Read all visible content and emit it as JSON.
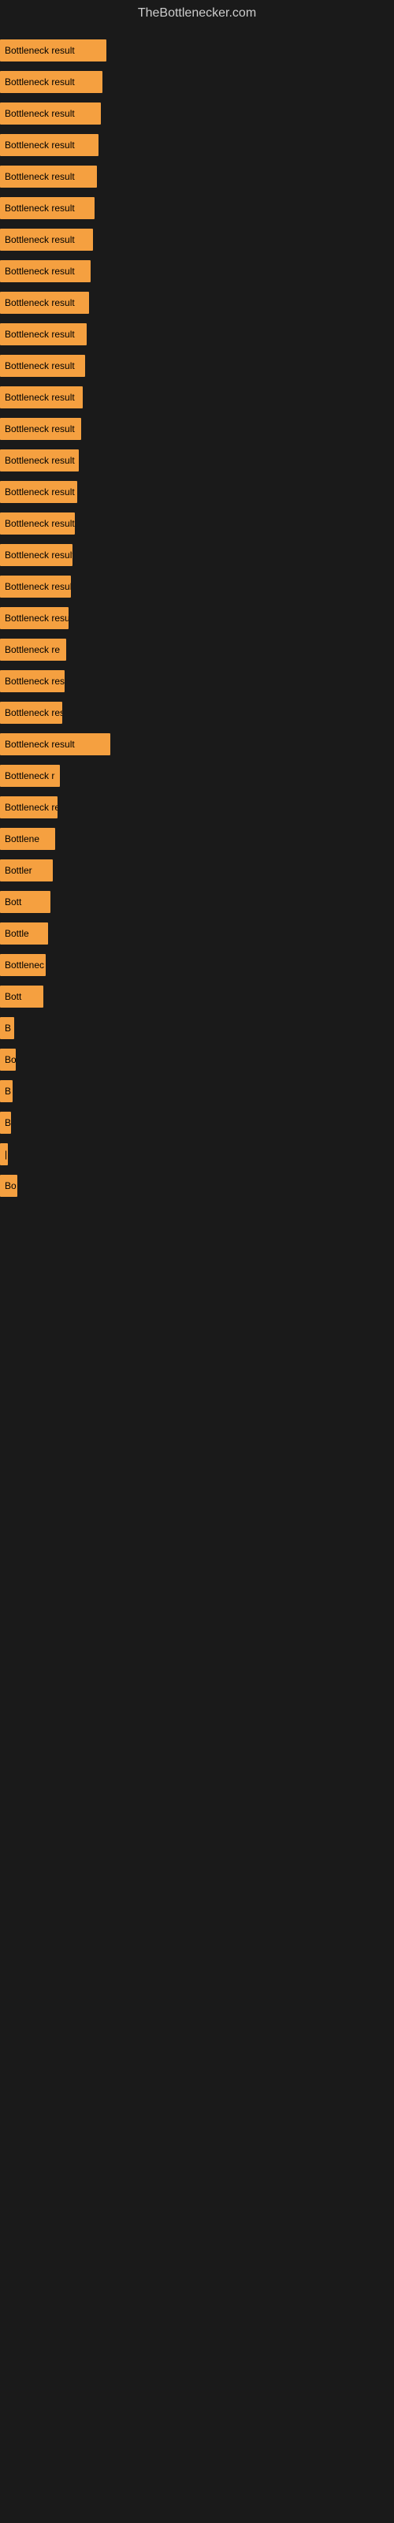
{
  "site": {
    "title": "TheBottlenecker.com"
  },
  "bars": [
    {
      "label": "Bottleneck result",
      "width": 135
    },
    {
      "label": "Bottleneck result",
      "width": 130
    },
    {
      "label": "Bottleneck result",
      "width": 128
    },
    {
      "label": "Bottleneck result",
      "width": 125
    },
    {
      "label": "Bottleneck result",
      "width": 123
    },
    {
      "label": "Bottleneck result",
      "width": 120
    },
    {
      "label": "Bottleneck result",
      "width": 118
    },
    {
      "label": "Bottleneck result",
      "width": 115
    },
    {
      "label": "Bottleneck result",
      "width": 113
    },
    {
      "label": "Bottleneck result",
      "width": 110
    },
    {
      "label": "Bottleneck result",
      "width": 108
    },
    {
      "label": "Bottleneck result",
      "width": 105
    },
    {
      "label": "Bottleneck result",
      "width": 103
    },
    {
      "label": "Bottleneck result",
      "width": 100
    },
    {
      "label": "Bottleneck result",
      "width": 98
    },
    {
      "label": "Bottleneck result",
      "width": 95
    },
    {
      "label": "Bottleneck result",
      "width": 92
    },
    {
      "label": "Bottleneck result",
      "width": 90
    },
    {
      "label": "Bottleneck resu",
      "width": 87
    },
    {
      "label": "Bottleneck re",
      "width": 84
    },
    {
      "label": "Bottleneck resu",
      "width": 82
    },
    {
      "label": "Bottleneck res",
      "width": 79
    },
    {
      "label": "Bottleneck result",
      "width": 140
    },
    {
      "label": "Bottleneck r",
      "width": 76
    },
    {
      "label": "Bottleneck resu",
      "width": 73
    },
    {
      "label": "Bottlene",
      "width": 70
    },
    {
      "label": "Bottler",
      "width": 67
    },
    {
      "label": "Bott",
      "width": 64
    },
    {
      "label": "Bottle",
      "width": 61
    },
    {
      "label": "Bottlenec",
      "width": 58
    },
    {
      "label": "Bott",
      "width": 55
    },
    {
      "label": "B",
      "width": 18
    },
    {
      "label": "Bo",
      "width": 20
    },
    {
      "label": "B",
      "width": 16
    },
    {
      "label": "B",
      "width": 14
    },
    {
      "label": "|",
      "width": 10
    },
    {
      "label": "Bo",
      "width": 22
    }
  ]
}
